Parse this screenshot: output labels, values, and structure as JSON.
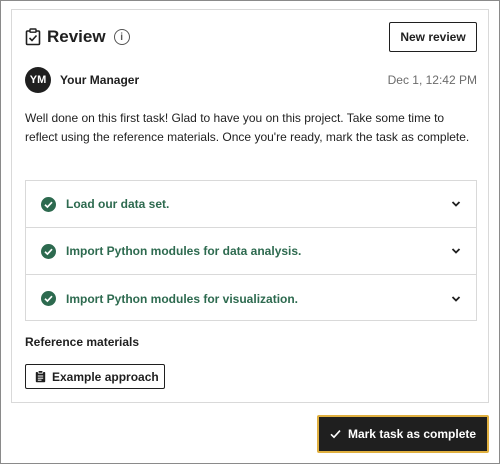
{
  "review": {
    "title": "Review",
    "info_icon": "i",
    "new_review_label": "New review"
  },
  "author": {
    "initials": "YM",
    "name": "Your Manager",
    "timestamp": "Dec 1, 12:42 PM"
  },
  "message": "Well done on this first task! Glad to have you on this project. Take some time to reflect using the reference materials. Once you're ready, mark the task as complete.",
  "tasks": [
    {
      "label": "Load our data set.",
      "status": "complete",
      "icon": "check-circle-icon"
    },
    {
      "label": "Import Python modules for data analysis.",
      "status": "complete",
      "icon": "check-circle-icon"
    },
    {
      "label": "Import Python modules for visualization.",
      "status": "complete",
      "icon": "check-circle-icon"
    }
  ],
  "reference": {
    "heading": "Reference materials",
    "example_label": "Example approach"
  },
  "footer": {
    "complete_label": "Mark task as complete"
  },
  "colors": {
    "accent_green": "#2d6a4f",
    "button_dark": "#1f1f1f",
    "focus_ring": "#e0b040"
  }
}
